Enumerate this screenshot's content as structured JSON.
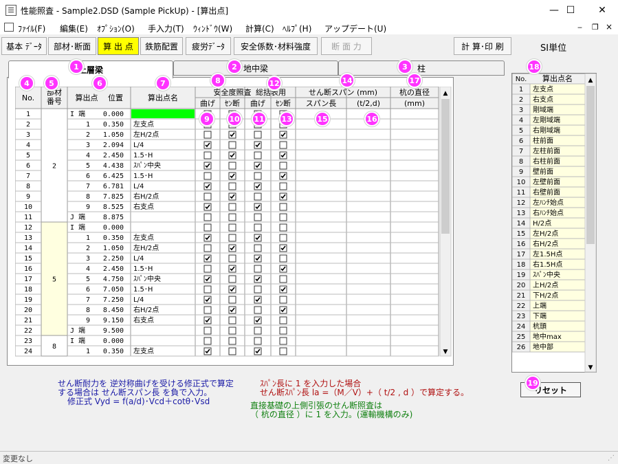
{
  "window": {
    "title": "性能照査 - Sample2.DSD (Sample PickUp) - [算出点]",
    "minimize": "—",
    "maximize": "☐",
    "close": "✕"
  },
  "menu": [
    "ﾌｧｲﾙ(F)",
    "編集(E)",
    "ｵﾌﾟｼｮﾝ(O)",
    "手入力(T)",
    "ｳｨﾝﾄﾞｳ(W)",
    "計算(C)",
    "ﾍﾙﾌﾟ(H)",
    "アップデート(U)"
  ],
  "toolbar": [
    "基本 ﾃﾞｰﾀ",
    "部材･断面",
    "算 出 点",
    "鉄筋配置",
    "疲労ﾃﾞｰﾀ",
    "安全係数･材料強度",
    "断 面 力",
    "計 算･印 刷"
  ],
  "si_unit": "SI単位",
  "tabs": [
    "上層梁",
    "地中梁",
    "柱"
  ],
  "headers": {
    "no": "No.",
    "member": "部材",
    "member2": "番号",
    "calc_pt": "算出点",
    "position": "位置",
    "name": "算出点名",
    "safety": "安全度照査",
    "bend": "曲げ",
    "shear": "ｾﾝ断",
    "general": "総括表用",
    "span_title": "せん断スパン (mm)",
    "span_len": "スパン長",
    "t2d": "(t/2,d)",
    "pile_title": "杭の直径",
    "pile_unit": "(mm)"
  },
  "rows": [
    {
      "no": "1",
      "calc": "I 端",
      "pos": "0.000",
      "name": "",
      "c": [
        0,
        0,
        0,
        0
      ]
    },
    {
      "no": "2",
      "calc": "1",
      "pos": "0.350",
      "name": "左支点",
      "c": [
        0,
        0,
        0,
        0
      ]
    },
    {
      "no": "3",
      "calc": "2",
      "pos": "1.050",
      "name": "左H/2点",
      "c": [
        0,
        1,
        0,
        1
      ]
    },
    {
      "no": "4",
      "calc": "3",
      "pos": "2.094",
      "name": "L/4",
      "c": [
        1,
        0,
        1,
        0
      ]
    },
    {
      "no": "5",
      "calc": "4",
      "pos": "2.450",
      "name": "1.5･H",
      "c": [
        0,
        1,
        0,
        1
      ]
    },
    {
      "no": "6",
      "calc": "5",
      "pos": "4.438",
      "name": "ｽﾊﾟﾝ中央",
      "c": [
        1,
        0,
        1,
        0
      ]
    },
    {
      "no": "7",
      "calc": "6",
      "pos": "6.425",
      "name": "1.5･H",
      "c": [
        0,
        1,
        0,
        1
      ]
    },
    {
      "no": "8",
      "calc": "7",
      "pos": "6.781",
      "name": "L/4",
      "c": [
        1,
        0,
        1,
        0
      ]
    },
    {
      "no": "9",
      "calc": "8",
      "pos": "7.825",
      "name": "右H/2点",
      "c": [
        0,
        1,
        0,
        1
      ]
    },
    {
      "no": "10",
      "calc": "9",
      "pos": "8.525",
      "name": "右支点",
      "c": [
        1,
        0,
        1,
        0
      ]
    },
    {
      "no": "11",
      "calc": "J 端",
      "pos": "8.875",
      "name": "",
      "c": [
        0,
        0,
        0,
        0
      ]
    },
    {
      "no": "12",
      "calc": "I 端",
      "pos": "0.000",
      "name": "",
      "c": [
        0,
        0,
        0,
        0
      ]
    },
    {
      "no": "13",
      "calc": "1",
      "pos": "0.350",
      "name": "左支点",
      "c": [
        1,
        0,
        1,
        0
      ]
    },
    {
      "no": "14",
      "calc": "2",
      "pos": "1.050",
      "name": "左H/2点",
      "c": [
        0,
        1,
        0,
        1
      ]
    },
    {
      "no": "15",
      "calc": "3",
      "pos": "2.250",
      "name": "L/4",
      "c": [
        1,
        0,
        1,
        0
      ]
    },
    {
      "no": "16",
      "calc": "4",
      "pos": "2.450",
      "name": "1.5･H",
      "c": [
        0,
        1,
        0,
        1
      ]
    },
    {
      "no": "17",
      "calc": "5",
      "pos": "4.750",
      "name": "ｽﾊﾟﾝ中央",
      "c": [
        1,
        0,
        1,
        0
      ]
    },
    {
      "no": "18",
      "calc": "6",
      "pos": "7.050",
      "name": "1.5･H",
      "c": [
        0,
        1,
        0,
        1
      ]
    },
    {
      "no": "19",
      "calc": "7",
      "pos": "7.250",
      "name": "L/4",
      "c": [
        1,
        0,
        1,
        0
      ]
    },
    {
      "no": "20",
      "calc": "8",
      "pos": "8.450",
      "name": "右H/2点",
      "c": [
        0,
        1,
        0,
        1
      ]
    },
    {
      "no": "21",
      "calc": "9",
      "pos": "9.150",
      "name": "右支点",
      "c": [
        1,
        0,
        1,
        0
      ]
    },
    {
      "no": "22",
      "calc": "J 端",
      "pos": "9.500",
      "name": "",
      "c": [
        0,
        0,
        0,
        0
      ]
    },
    {
      "no": "23",
      "calc": "I 端",
      "pos": "0.000",
      "name": "",
      "c": [
        0,
        0,
        0,
        0
      ]
    },
    {
      "no": "24",
      "calc": "1",
      "pos": "0.350",
      "name": "左支点",
      "c": [
        1,
        0,
        1,
        0
      ]
    }
  ],
  "members": [
    {
      "label": "2",
      "first": 1,
      "last": 11,
      "bg": "#ffffff"
    },
    {
      "label": "5",
      "first": 12,
      "last": 22,
      "bg": "#ffffe0"
    },
    {
      "label": "8",
      "first": 23,
      "last": 24,
      "bg": "#ffffff"
    }
  ],
  "list": {
    "header_no": "No.",
    "header_name": "算出点名",
    "items": [
      "左支点",
      "右支点",
      "剛域端",
      "左剛域端",
      "右剛域端",
      "柱前面",
      "左柱前面",
      "右柱前面",
      "壁前面",
      "左壁前面",
      "右壁前面",
      "左ﾊﾝﾁ始点",
      "右ﾊﾝﾁ始点",
      "H/2点",
      "左H/2点",
      "右H/2点",
      "左1.5H点",
      "右1.5H点",
      "ｽﾊﾟﾝ中央",
      "上H/2点",
      "下H/2点",
      "上端",
      "下端",
      "杭頭",
      "地中max",
      "地中部"
    ]
  },
  "badges": [
    "1",
    "2",
    "3",
    "4",
    "5",
    "6",
    "7",
    "8",
    "9",
    "10",
    "11",
    "12",
    "13",
    "14",
    "15",
    "16",
    "17",
    "18",
    "19"
  ],
  "notes_blue": [
    "せん断耐力を 逆対称曲げを受ける修正式で算定",
    "する場合は せん断スパン長 を負で入力。",
    "修正式  Vyd = f(a/d)･Vcd＋cotθ･Vsd"
  ],
  "notes_red": [
    "ｽﾊﾟﾝ長に 1 を入力した場合",
    "せん断ｽﾊﾟﾝ長 la =（M／V）+（ t/2 , d ）で算定する。"
  ],
  "notes_green": [
    "直接基礎の上側引張のせん断照査は",
    "（ 杭の直径 ）に 1 を入力。(運輸機構のみ)"
  ],
  "reset_label": "リセット",
  "status": "変更なし",
  "colors": {
    "selected_cell": "#00ff00",
    "badge": "#ff33ff",
    "yellow": "#ffffe0",
    "active_button": "#ffff00"
  }
}
